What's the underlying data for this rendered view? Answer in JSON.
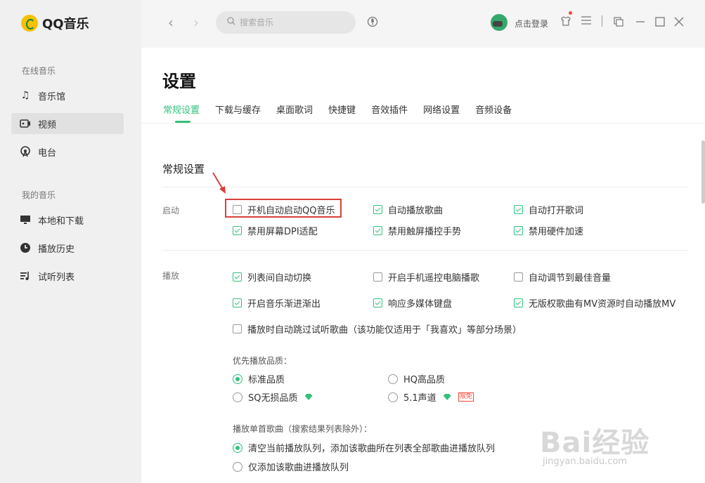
{
  "app": {
    "name": "QQ音乐"
  },
  "sidebar": {
    "online_section": "在线音乐",
    "online_items": [
      {
        "label": "音乐馆",
        "icon": "music-note-icon"
      },
      {
        "label": "视频",
        "icon": "video-icon"
      },
      {
        "label": "电台",
        "icon": "radio-icon"
      }
    ],
    "my_section": "我的音乐",
    "my_items": [
      {
        "label": "本地和下载",
        "icon": "monitor-icon"
      },
      {
        "label": "播放历史",
        "icon": "clock-icon"
      },
      {
        "label": "试听列表",
        "icon": "playlist-icon"
      }
    ]
  },
  "topbar": {
    "search_placeholder": "搜索音乐",
    "login_label": "点击登录"
  },
  "page": {
    "title": "设置",
    "tabs": [
      "常规设置",
      "下载与缓存",
      "桌面歌词",
      "快捷键",
      "音效插件",
      "网络设置",
      "音频设备"
    ],
    "active_tab": "常规设置"
  },
  "general": {
    "section_title": "常规设置",
    "startup": {
      "label": "启动",
      "options": [
        {
          "label": "开机自动启动QQ音乐",
          "checked": false
        },
        {
          "label": "自动播放歌曲",
          "checked": true
        },
        {
          "label": "自动打开歌词",
          "checked": true
        },
        {
          "label": "禁用屏幕DPI适配",
          "checked": true
        },
        {
          "label": "禁用触屏播控手势",
          "checked": true
        },
        {
          "label": "禁用硬件加速",
          "checked": true
        }
      ]
    },
    "playback": {
      "label": "播放",
      "options": [
        {
          "label": "列表间自动切换",
          "checked": true
        },
        {
          "label": "开启手机遥控电脑播歌",
          "checked": false
        },
        {
          "label": "自动调节到最佳音量",
          "checked": false
        },
        {
          "label": "开启音乐渐进渐出",
          "checked": true
        },
        {
          "label": "响应多媒体键盘",
          "checked": true
        },
        {
          "label": "无版权歌曲有MV资源时自动播放MV",
          "checked": true
        },
        {
          "label": "播放时自动跳过试听歌曲（该功能仅适用于「我喜欢」等部分场景）",
          "checked": false
        }
      ],
      "quality_label": "优先播放品质：",
      "quality_options": [
        {
          "label": "标准品质",
          "checked": true
        },
        {
          "label": "HQ高品质",
          "checked": false
        },
        {
          "label": "SQ无损品质",
          "checked": false
        },
        {
          "label": "5.1声道",
          "checked": false,
          "badge": "限免"
        }
      ],
      "single_label": "播放单首歌曲（搜索结果列表除外）：",
      "single_options": [
        {
          "label": "清空当前播放队列，添加该歌曲所在列表全部歌曲进播放队列",
          "checked": true
        },
        {
          "label": "仅添加该歌曲进播放队列",
          "checked": false
        }
      ]
    }
  },
  "watermark": {
    "brand": "Bai经验",
    "url": "jingyan.baidu.com"
  },
  "colors": {
    "accent": "#31c27c",
    "highlight": "#d9403a"
  }
}
